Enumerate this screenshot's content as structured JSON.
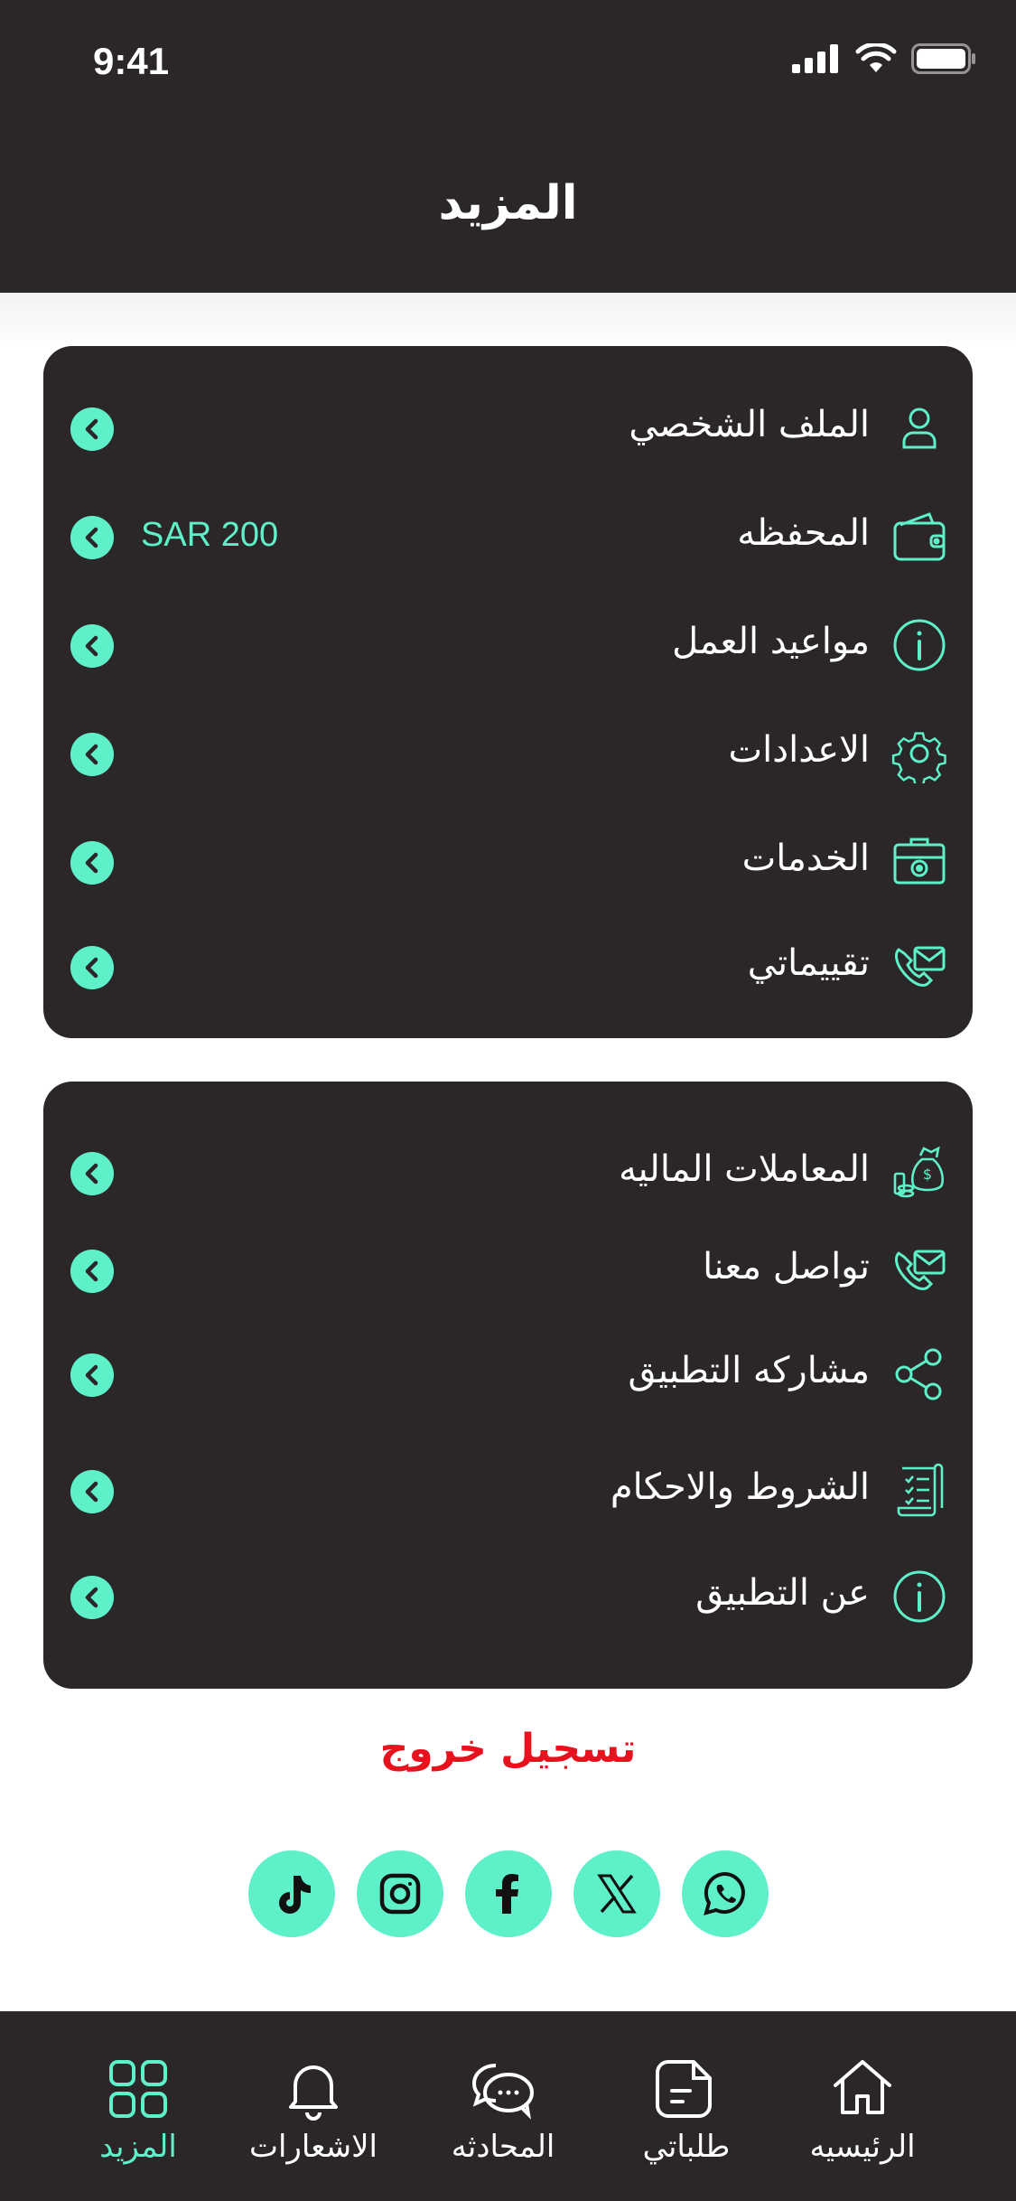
{
  "status": {
    "time": "9:41"
  },
  "header": {
    "title": "المزيد"
  },
  "card1": {
    "items": [
      {
        "label": "الملف الشخصي",
        "value": "",
        "icon": "user-icon"
      },
      {
        "label": "المحفظه",
        "value": "SAR 200",
        "icon": "wallet-icon"
      },
      {
        "label": "مواعيد العمل",
        "value": "",
        "icon": "info-icon"
      },
      {
        "label": "الاعدادات",
        "value": "",
        "icon": "gear-icon"
      },
      {
        "label": "الخدمات",
        "value": "",
        "icon": "toolbox-icon"
      },
      {
        "label": "تقييماتي",
        "value": "",
        "icon": "phone-mail-icon"
      }
    ]
  },
  "card2": {
    "items": [
      {
        "label": "المعاملات الماليه",
        "icon": "money-bag-icon"
      },
      {
        "label": "تواصل معنا",
        "icon": "phone-mail-icon"
      },
      {
        "label": "مشاركه التطبيق",
        "icon": "share-icon"
      },
      {
        "label": "الشروط والاحكام",
        "icon": "checklist-icon"
      },
      {
        "label": "عن التطبيق",
        "icon": "info-icon"
      }
    ]
  },
  "logout": {
    "label": "تسجيل خروج"
  },
  "socials": [
    "tiktok-icon",
    "instagram-icon",
    "facebook-icon",
    "x-icon",
    "whatsapp-icon"
  ],
  "tabbar": {
    "items": [
      {
        "label": "المزيد",
        "icon": "grid-icon",
        "active": true
      },
      {
        "label": "الاشعارات",
        "icon": "bell-icon",
        "active": false
      },
      {
        "label": "المحادثه",
        "icon": "chat-icon",
        "active": false
      },
      {
        "label": "طلباتي",
        "icon": "document-icon",
        "active": false
      },
      {
        "label": "الرئيسيه",
        "icon": "home-icon",
        "active": false
      }
    ]
  },
  "colors": {
    "dark": "#2b2728",
    "accent": "#5ef0c8",
    "danger": "#e8121f"
  }
}
